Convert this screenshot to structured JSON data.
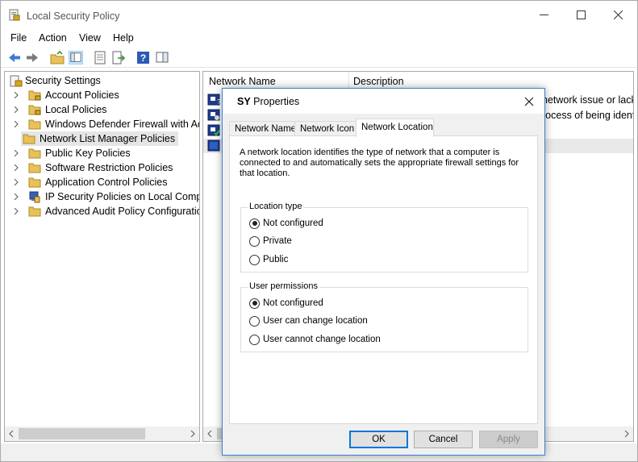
{
  "window": {
    "title": "Local Security Policy"
  },
  "menu": [
    "File",
    "Action",
    "View",
    "Help"
  ],
  "tree": {
    "root": "Security Settings",
    "items": [
      {
        "label": "Account Policies",
        "icon": "folder-lock-icon"
      },
      {
        "label": "Local Policies",
        "icon": "folder-lock-icon"
      },
      {
        "label": "Windows Defender Firewall with Adva",
        "icon": "folder-icon"
      },
      {
        "label": "Network List Manager Policies",
        "icon": "folder-icon",
        "selected": true
      },
      {
        "label": "Public Key Policies",
        "icon": "folder-icon"
      },
      {
        "label": "Software Restriction Policies",
        "icon": "folder-icon"
      },
      {
        "label": "Application Control Policies",
        "icon": "folder-icon"
      },
      {
        "label": "IP Security Policies on Local Compute",
        "icon": "ip-security-icon"
      },
      {
        "label": "Advanced Audit Policy Configuration",
        "icon": "folder-icon"
      }
    ]
  },
  "list": {
    "columns": [
      "Network Name",
      "Description"
    ],
    "rows": [
      {
        "description": "network issue or lack o"
      },
      {
        "description": "rocess of being ident"
      },
      {
        "description": ""
      },
      {
        "description": ""
      }
    ]
  },
  "dialog": {
    "title_bold": "SY",
    "title_rest": "Properties",
    "tabs": [
      "Network Name",
      "Network Icon",
      "Network Location"
    ],
    "active_tab": "Network Location",
    "description": "A network location identifies the type of network that a computer is connected to and automatically sets the appropriate firewall settings for that location.",
    "location_type": {
      "title": "Location type",
      "options": [
        "Not configured",
        "Private",
        "Public"
      ],
      "selected": "Not configured"
    },
    "user_permissions": {
      "title": "User permissions",
      "options": [
        "Not configured",
        "User can change location",
        "User cannot change location"
      ],
      "selected": "Not configured"
    },
    "buttons": {
      "ok": "OK",
      "cancel": "Cancel",
      "apply": "Apply"
    }
  },
  "colors": {
    "accent": "#0078d7",
    "selection": "#cce8ff",
    "dialog_border": "#3b7fd2"
  }
}
